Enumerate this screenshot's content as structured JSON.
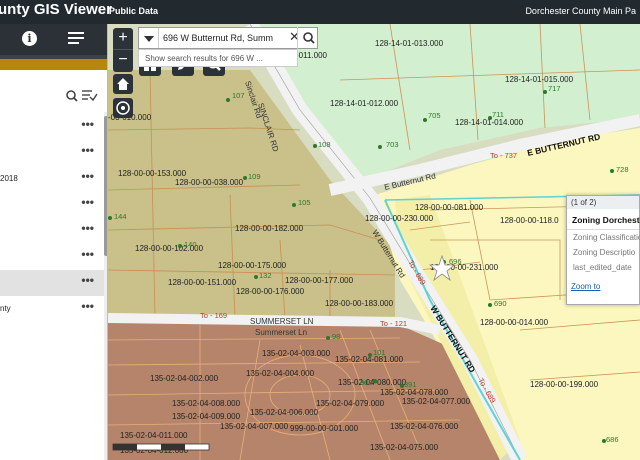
{
  "header": {
    "title": "unty GIS Viewer",
    "public_data": "Public Data",
    "county_link": "Dorchester County Main Pa"
  },
  "panel": {
    "items": [
      {
        "label": ""
      },
      {
        "label": ""
      },
      {
        "label": "2018"
      },
      {
        "label": ""
      },
      {
        "label": ""
      },
      {
        "label": ""
      },
      {
        "label": "",
        "selected": true
      },
      {
        "label": "nty"
      }
    ],
    "more_label": "•••"
  },
  "search": {
    "value": "696 W Butternut Rd, Summ",
    "suggestion": "Show search results for 696 W ..."
  },
  "popup": {
    "pager": "(1 of 2)",
    "title": "Zoning Dorchester",
    "fields": [
      "Zoning Classificatio",
      "Zoning Descriptio",
      "last_edited_date"
    ],
    "zoom_link": "Zoom to"
  },
  "map": {
    "parcels": [
      {
        "text": "128-14-01-013.000"
      },
      {
        "text": "-011.000"
      },
      {
        "text": "128-14-01-015.000"
      },
      {
        "text": "128-14-01-012.000"
      },
      {
        "text": "128-14-01-014.000"
      },
      {
        "text": "-03-010.000"
      },
      {
        "text": "128-00-00-153.000"
      },
      {
        "text": "128-00-00-038.000"
      },
      {
        "text": "128-00-00-182.000"
      },
      {
        "text": "128-00-00-102.000"
      },
      {
        "text": "128-00-00-175.000"
      },
      {
        "text": "128-00-00-151.000"
      },
      {
        "text": "128-00-00-176.000"
      },
      {
        "text": "128-00-00-177.000"
      },
      {
        "text": "128-00-00-183.000"
      },
      {
        "text": "128-00-00-081.000"
      },
      {
        "text": "128-00-00-230.000"
      },
      {
        "text": "128-00-00-118.0"
      },
      {
        "text": "128-00-00-231.000"
      },
      {
        "text": "128-00-00-014.000"
      },
      {
        "text": "128-00-00-199.000"
      },
      {
        "text": "135-02-04-003.000"
      },
      {
        "text": "135-02-04-081.000"
      },
      {
        "text": "135-02-04-002.000"
      },
      {
        "text": "135-02-04-004.000"
      },
      {
        "text": "135-02-04-080.000"
      },
      {
        "text": "135-02-04-078.000"
      },
      {
        "text": "135-02-04-008.000"
      },
      {
        "text": "135-02-04-079.000"
      },
      {
        "text": "135-02-04-077.000"
      },
      {
        "text": "135-02-04-009.000"
      },
      {
        "text": "135-02-04-006.000"
      },
      {
        "text": "135-02-04-007.000"
      },
      {
        "text": "999-00-00-001.000"
      },
      {
        "text": "135-02-04-076.000"
      },
      {
        "text": "135-02-04-011.000"
      },
      {
        "text": "135-02-04-012.000"
      },
      {
        "text": "135-02-04-075.000"
      }
    ],
    "addresses": [
      "107",
      "705",
      "711",
      "717",
      "108",
      "703",
      "728",
      "109",
      "105",
      "144",
      "140",
      "132",
      "696",
      "690",
      "686",
      "98",
      "101",
      "391",
      "380"
    ],
    "roads": {
      "butternut_e": "E BUTTERNUT RD",
      "butternut_e_small": "E Butternut Rd",
      "butternut_w": "W BUTTERNUT RD",
      "butternut_w_small": "W Butternut Rd",
      "sinclair": "SINCLAIR RD",
      "sinclair_small": "Sinclair Rd",
      "summerset": "SUMMERSET LN",
      "summerset_small": "Summerset Ln",
      "to_737": "To - 737",
      "to_169": "To - 169",
      "to_121": "To - 121",
      "to_689": "To - 689",
      "to_689b": "To - 689"
    }
  },
  "colors": {
    "header_bg": "#222a30",
    "green_zone": "#d4f0d0",
    "olive_zone": "#c9c08a",
    "yellow_zone": "#fbf7c0",
    "brown_zone": "#b7856a",
    "road": "#f0f0f0",
    "highlight": "#5fd3d3"
  }
}
